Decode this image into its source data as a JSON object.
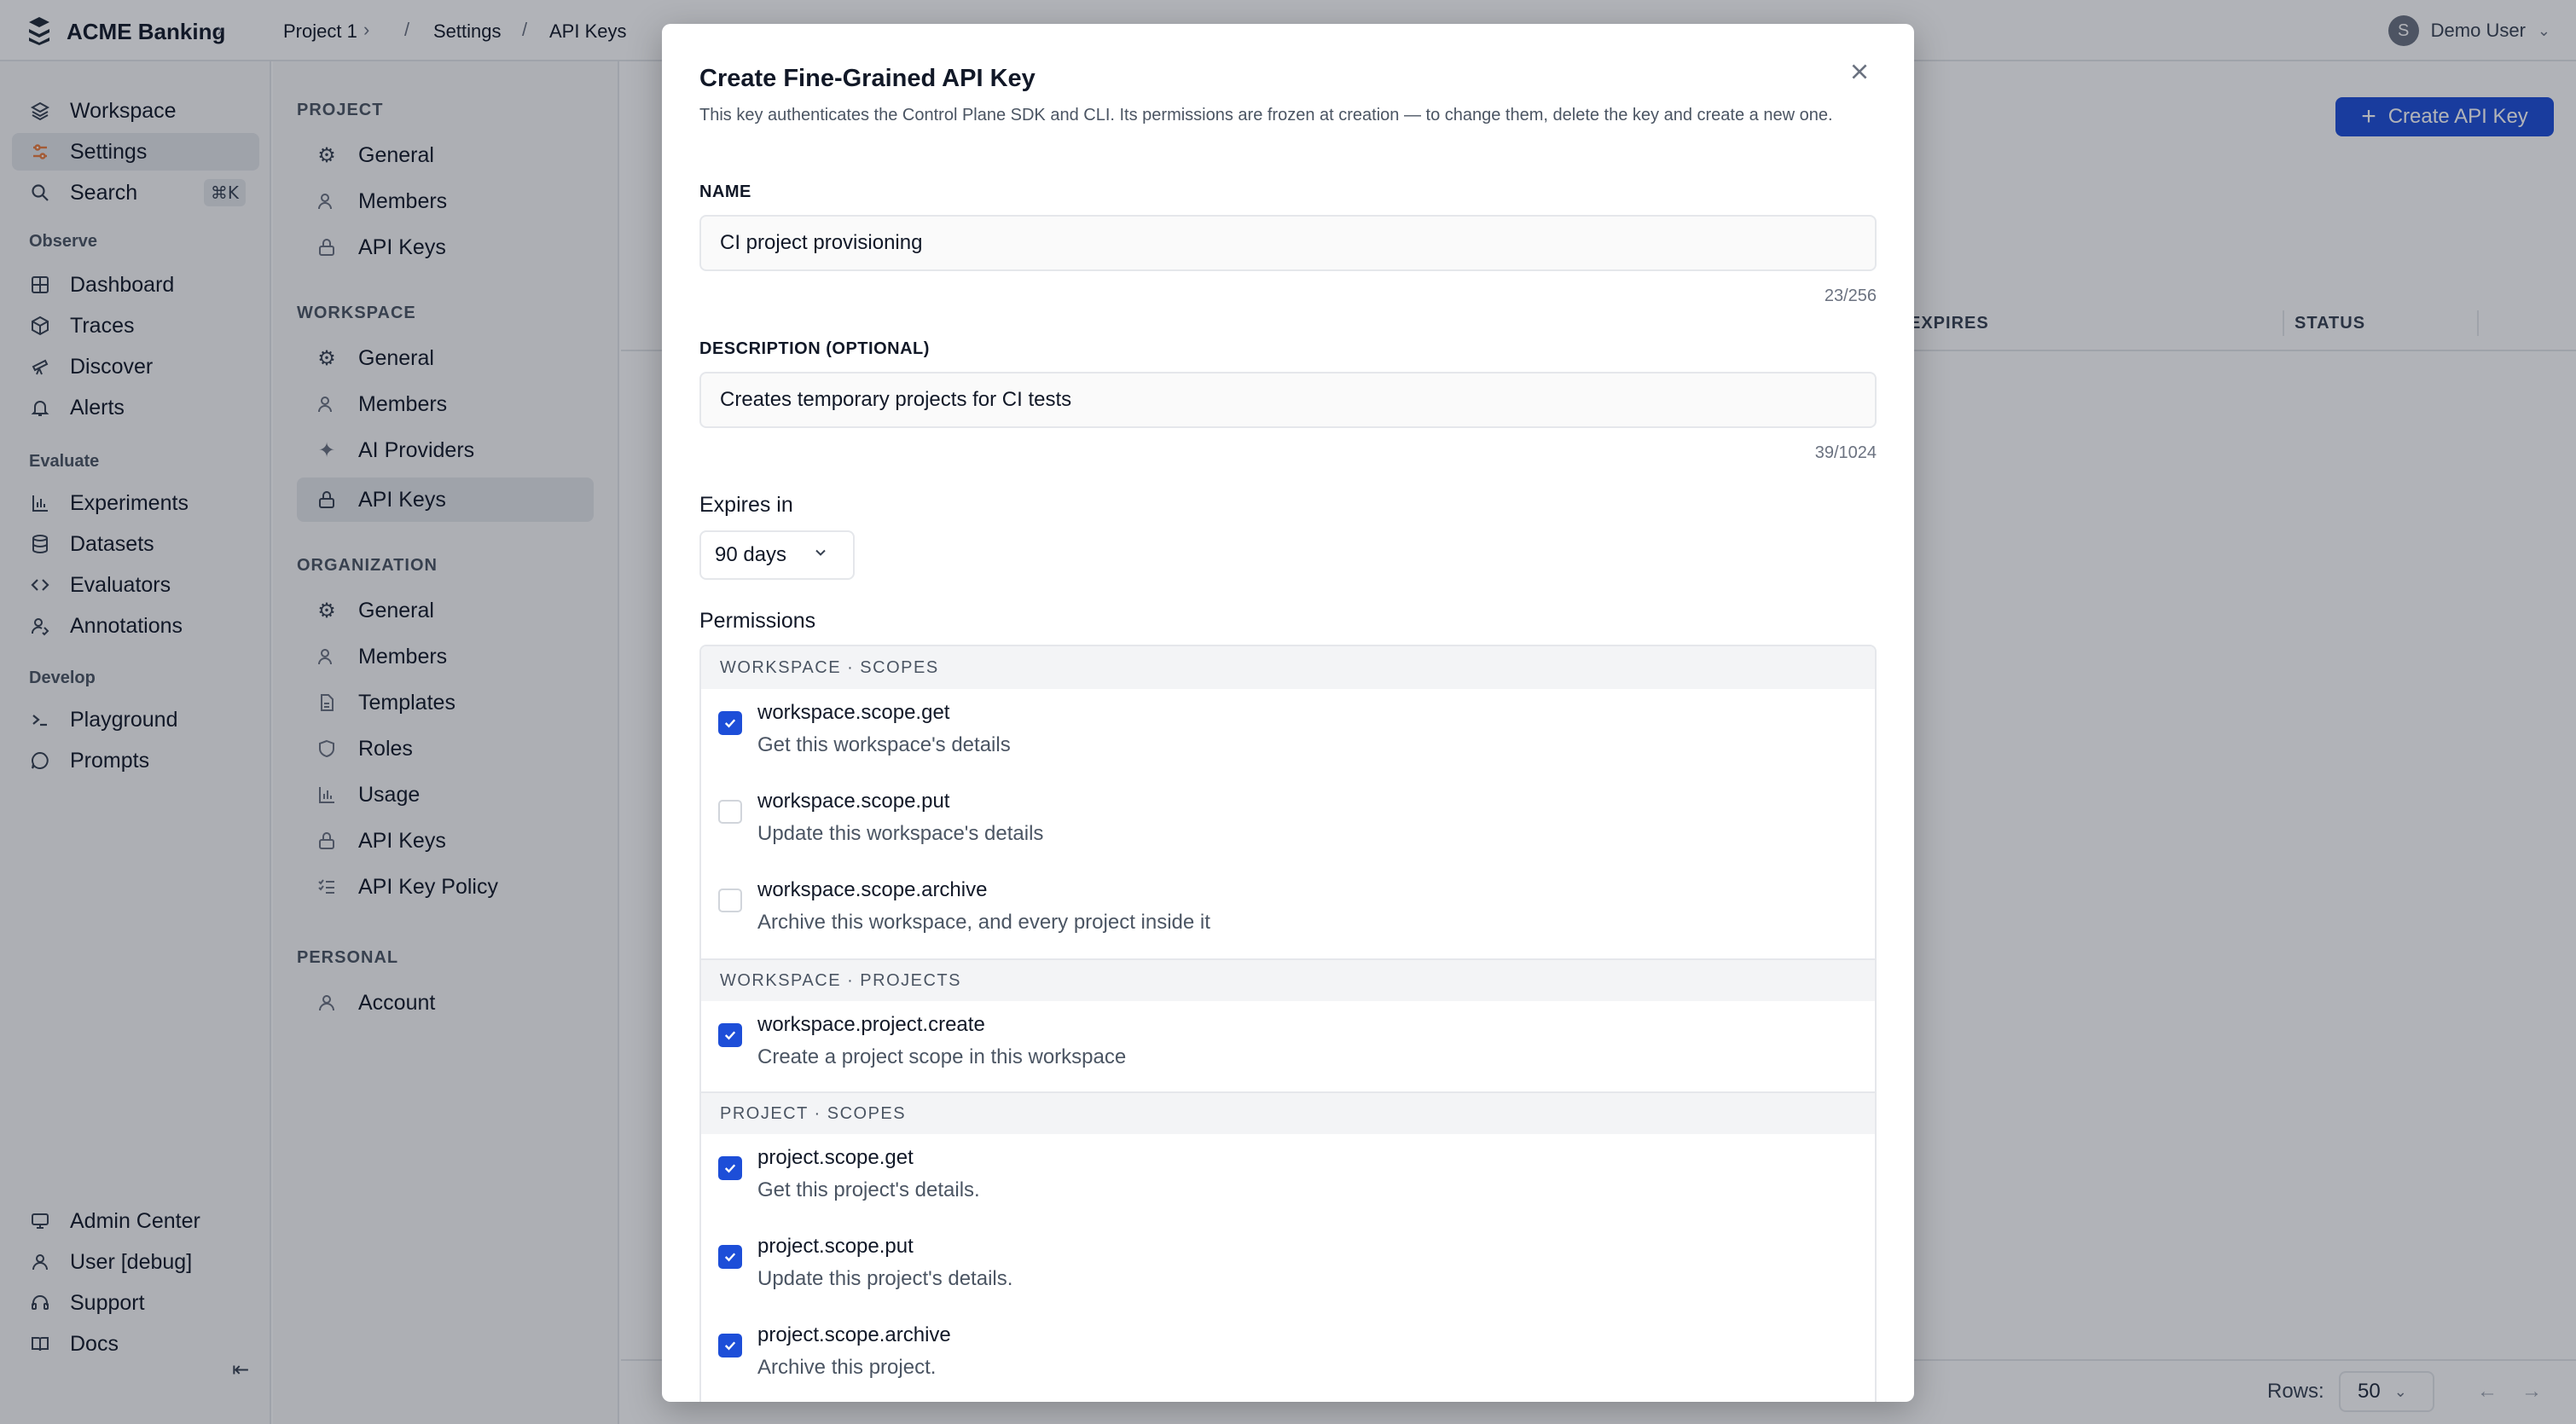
{
  "topbar": {
    "brand": "ACME Banking",
    "breadcrumbs": [
      "Project 1",
      "Settings",
      "API Keys"
    ],
    "user_initial": "S",
    "user_name": "Demo User"
  },
  "sidebar": {
    "top_items": [
      {
        "label": "Workspace",
        "icon": "layers-icon"
      },
      {
        "label": "Settings",
        "icon": "sliders-icon"
      },
      {
        "label": "Search",
        "icon": "search-icon",
        "shortcut": "⌘K"
      }
    ],
    "sections": [
      {
        "title": "Observe",
        "items": [
          {
            "label": "Dashboard",
            "icon": "grid-icon"
          },
          {
            "label": "Traces",
            "icon": "cube-icon"
          },
          {
            "label": "Discover",
            "icon": "telescope-icon"
          },
          {
            "label": "Alerts",
            "icon": "bell-icon"
          }
        ]
      },
      {
        "title": "Evaluate",
        "items": [
          {
            "label": "Experiments",
            "icon": "bar-chart-icon"
          },
          {
            "label": "Datasets",
            "icon": "database-icon"
          },
          {
            "label": "Evaluators",
            "icon": "code-icon"
          },
          {
            "label": "Annotations",
            "icon": "user-pen-icon"
          }
        ]
      },
      {
        "title": "Develop",
        "items": [
          {
            "label": "Playground",
            "icon": "terminal-icon"
          },
          {
            "label": "Prompts",
            "icon": "chat-icon"
          }
        ]
      }
    ],
    "bottom_items": [
      {
        "label": "Admin Center",
        "icon": "monitor-icon"
      },
      {
        "label": "User [debug]",
        "icon": "user-icon"
      },
      {
        "label": "Support",
        "icon": "headset-icon"
      },
      {
        "label": "Docs",
        "icon": "book-icon"
      }
    ]
  },
  "settings_nav": {
    "sections": [
      {
        "title": "PROJECT",
        "items": [
          "General",
          "Members",
          "API Keys"
        ]
      },
      {
        "title": "WORKSPACE",
        "items": [
          "General",
          "Members",
          "AI Providers",
          "API Keys"
        ]
      },
      {
        "title": "ORGANIZATION",
        "items": [
          "General",
          "Members",
          "Templates",
          "Roles",
          "Usage",
          "API Keys",
          "API Key Policy"
        ]
      },
      {
        "title": "PERSONAL",
        "items": [
          "Account"
        ]
      }
    ]
  },
  "main": {
    "create_button": "Create API Key",
    "columns": [
      "EXPIRES",
      "STATUS"
    ],
    "rows_label": "Rows:",
    "rows_value": "50"
  },
  "modal": {
    "title": "Create Fine-Grained API Key",
    "description": "This key authenticates the Control Plane SDK and CLI. Its permissions are frozen at creation — to change them, delete the key and create a new one.",
    "name_label": "NAME",
    "name_value": "CI project provisioning",
    "name_count": "23/256",
    "desc_label": "DESCRIPTION (OPTIONAL)",
    "desc_value": "Creates temporary projects for CI tests",
    "desc_count": "39/1024",
    "expires_label": "Expires in",
    "expires_value": "90 days",
    "permissions_label": "Permissions",
    "groups": [
      {
        "title": "WORKSPACE · SCOPES",
        "perms": [
          {
            "name": "workspace.scope.get",
            "desc": "Get this workspace's details",
            "checked": true
          },
          {
            "name": "workspace.scope.put",
            "desc": "Update this workspace's details",
            "checked": false
          },
          {
            "name": "workspace.scope.archive",
            "desc": "Archive this workspace, and every project inside it",
            "checked": false
          }
        ]
      },
      {
        "title": "WORKSPACE · PROJECTS",
        "perms": [
          {
            "name": "workspace.project.create",
            "desc": "Create a project scope in this workspace",
            "checked": true
          }
        ]
      },
      {
        "title": "PROJECT · SCOPES",
        "perms": [
          {
            "name": "project.scope.get",
            "desc": "Get this project's details.",
            "checked": true
          },
          {
            "name": "project.scope.put",
            "desc": "Update this project's details.",
            "checked": true
          },
          {
            "name": "project.scope.archive",
            "desc": "Archive this project.",
            "checked": true
          }
        ]
      }
    ]
  },
  "colors": {
    "accent": "#1d4ed8",
    "settings_icon": "#ea7c3c"
  }
}
